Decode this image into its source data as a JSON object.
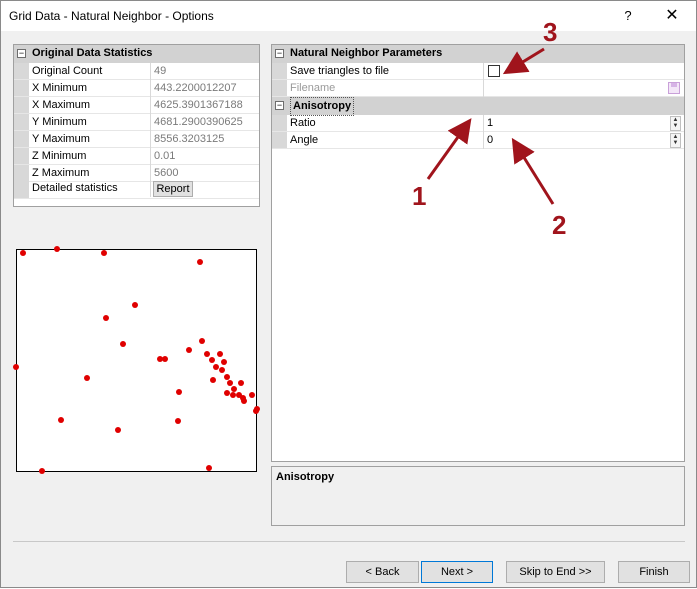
{
  "window": {
    "title": "Grid Data - Natural Neighbor - Options",
    "help": "?",
    "close": "✕"
  },
  "stats": {
    "header": "Original Data Statistics",
    "rows": [
      {
        "name": "Original Count",
        "value": "49"
      },
      {
        "name": "X Minimum",
        "value": "443.2200012207"
      },
      {
        "name": "X Maximum",
        "value": "4625.3901367188"
      },
      {
        "name": "Y Minimum",
        "value": "4681.2900390625"
      },
      {
        "name": "Y Maximum",
        "value": "8556.3203125"
      },
      {
        "name": "Z Minimum",
        "value": "0.01"
      },
      {
        "name": "Z Maximum",
        "value": "5600"
      }
    ],
    "detailed_label": "Detailed statistics",
    "report_button": "Report"
  },
  "params": {
    "header": "Natural Neighbor Parameters",
    "save_triangles_label": "Save triangles to file",
    "save_triangles_checked": false,
    "filename_label": "Filename",
    "anisotropy_header": "Anisotropy",
    "ratio_label": "Ratio",
    "ratio_value": "1",
    "angle_label": "Angle",
    "angle_value": "0"
  },
  "description": {
    "title": "Anisotropy"
  },
  "annotations": {
    "one": "1",
    "two": "2",
    "three": "3"
  },
  "buttons": {
    "back": "< Back",
    "next": "Next >",
    "skip": "Skip to End >>",
    "finish": "Finish"
  },
  "colors": {
    "point": "#e00000",
    "annotation": "#a0141c"
  }
}
